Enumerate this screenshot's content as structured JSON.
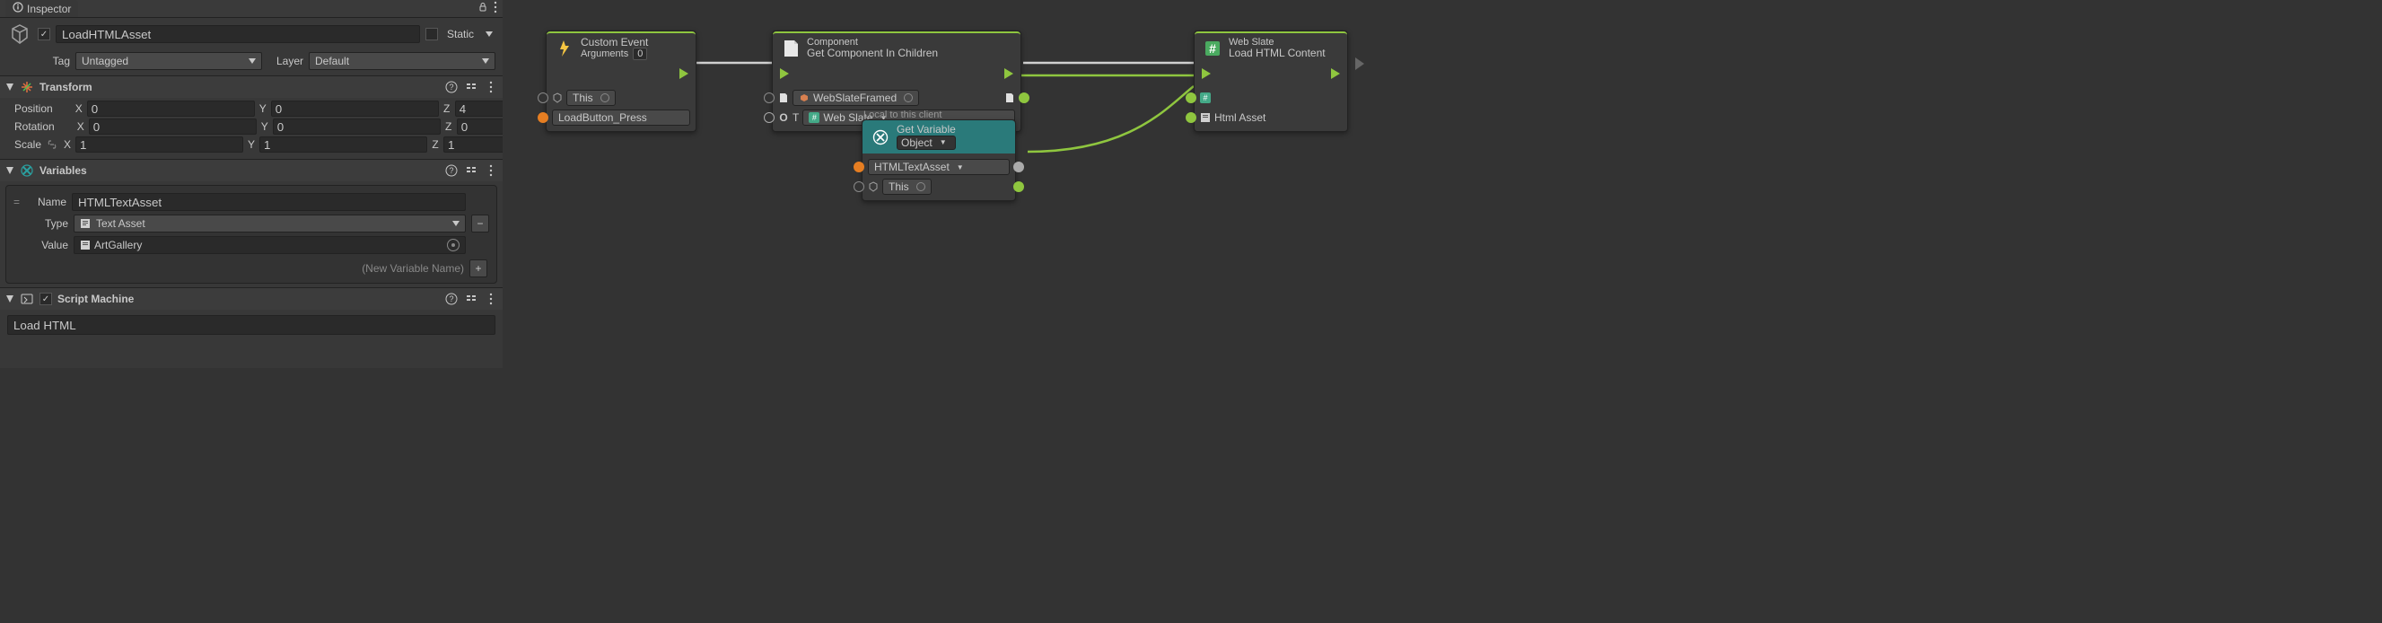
{
  "inspector": {
    "title": "Inspector",
    "go_name": "LoadHTMLAsset",
    "static_label": "Static",
    "tag_label": "Tag",
    "tag_value": "Untagged",
    "layer_label": "Layer",
    "layer_value": "Default"
  },
  "transform": {
    "title": "Transform",
    "position_label": "Position",
    "rotation_label": "Rotation",
    "scale_label": "Scale",
    "x": "X",
    "y": "Y",
    "z": "Z",
    "pos": {
      "x": "0",
      "y": "0",
      "z": "4"
    },
    "rot": {
      "x": "0",
      "y": "0",
      "z": "0"
    },
    "scl": {
      "x": "1",
      "y": "1",
      "z": "1"
    }
  },
  "variables": {
    "title": "Variables",
    "name_label": "Name",
    "name_value": "HTMLTextAsset",
    "type_label": "Type",
    "type_value": "Text Asset",
    "value_label": "Value",
    "value_value": "ArtGallery",
    "new_var": "(New Variable Name)"
  },
  "script_machine": {
    "title": "Script Machine",
    "graph_name": "Load HTML"
  },
  "nodes": {
    "custom_event": {
      "title_top": "Custom Event",
      "title_bottom": "Arguments",
      "badge": "0",
      "this": "This",
      "event_name": "LoadButton_Press"
    },
    "get_component": {
      "sub": "Component",
      "title": "Get Component In Children",
      "obj": "WebSlateFramed",
      "type_label": "T",
      "type_value": "Web Slate"
    },
    "get_variable": {
      "local_label": "Local to this client",
      "title": "Get Variable",
      "kind": "Object",
      "var_name": "HTMLTextAsset",
      "this": "This"
    },
    "load_html": {
      "sub": "Web Slate",
      "title": "Load HTML Content",
      "asset_label": "Html Asset"
    }
  },
  "colors": {
    "green": "#8fc63f",
    "orange": "#e67e22",
    "teal": "#2a9a9a"
  }
}
